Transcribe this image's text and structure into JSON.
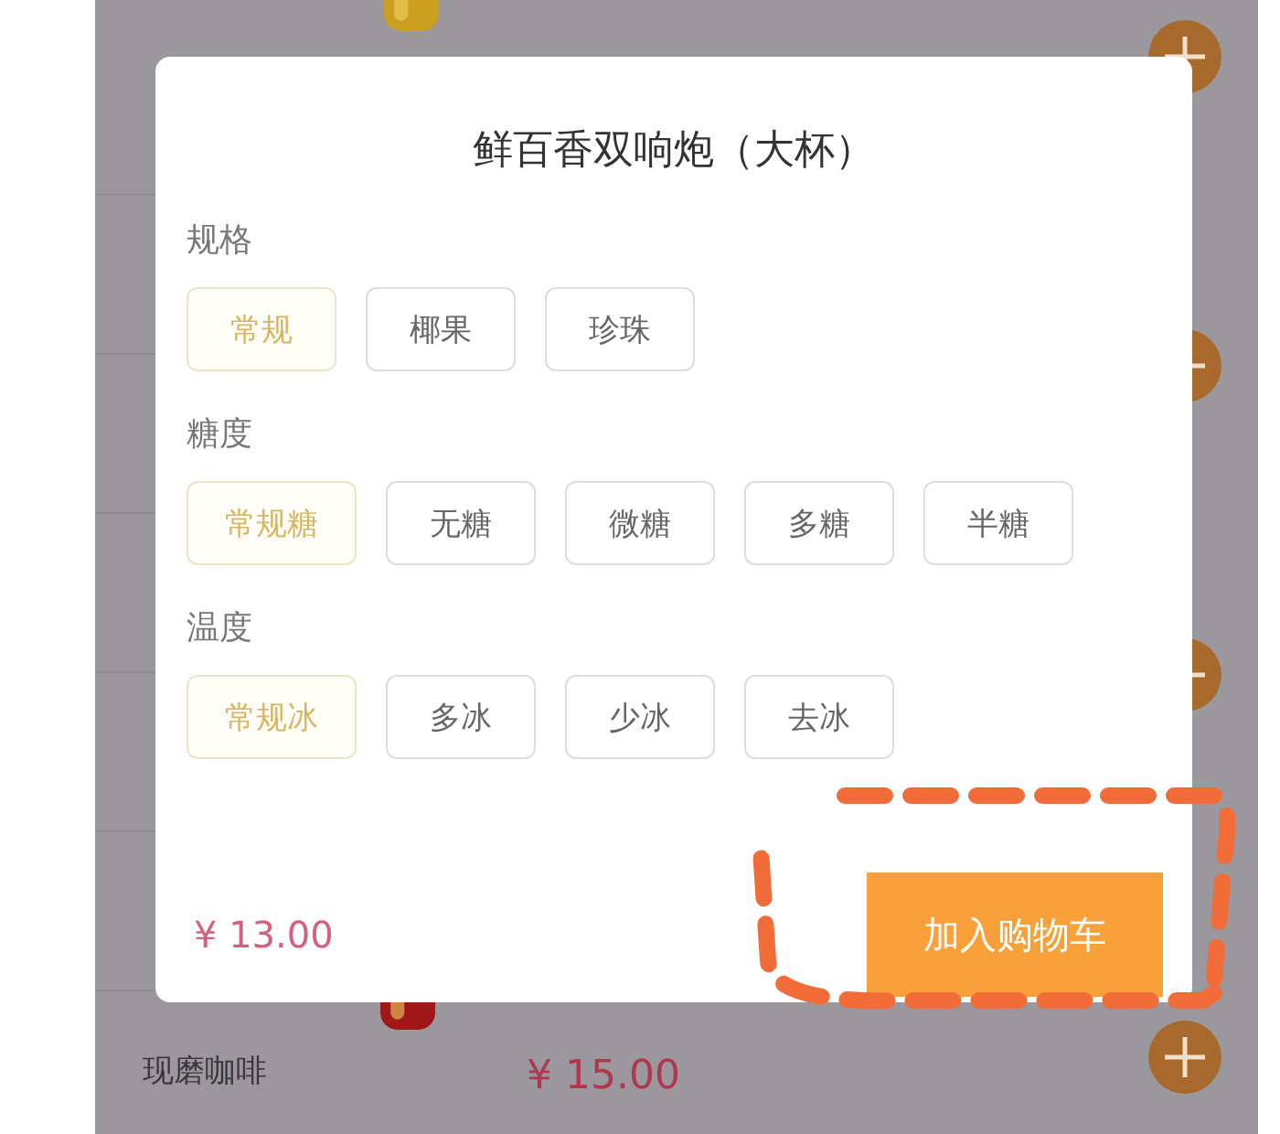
{
  "menu": {
    "rows": [
      {
        "category": "",
        "price": ""
      },
      {
        "category": "",
        "price": ""
      },
      {
        "category": "",
        "price": ""
      },
      {
        "category": "",
        "price": ""
      },
      {
        "category": "",
        "price": ""
      },
      {
        "category": "",
        "price": ""
      },
      {
        "category": "现磨咖啡",
        "price": "¥ 15.00"
      }
    ]
  },
  "dialog": {
    "title": "鲜百香双响炮（大杯）",
    "groups": [
      {
        "label": "规格",
        "options": [
          {
            "label": "常规",
            "selected": true
          },
          {
            "label": "椰果",
            "selected": false
          },
          {
            "label": "珍珠",
            "selected": false
          }
        ]
      },
      {
        "label": "糖度",
        "options": [
          {
            "label": "常规糖",
            "selected": true
          },
          {
            "label": "无糖",
            "selected": false
          },
          {
            "label": "微糖",
            "selected": false
          },
          {
            "label": "多糖",
            "selected": false
          },
          {
            "label": "半糖",
            "selected": false
          }
        ]
      },
      {
        "label": "温度",
        "options": [
          {
            "label": "常规冰",
            "selected": true
          },
          {
            "label": "多冰",
            "selected": false
          },
          {
            "label": "少冰",
            "selected": false
          },
          {
            "label": "去冰",
            "selected": false
          }
        ]
      }
    ],
    "price": "¥ 13.00",
    "add_button": "加入购物车"
  }
}
